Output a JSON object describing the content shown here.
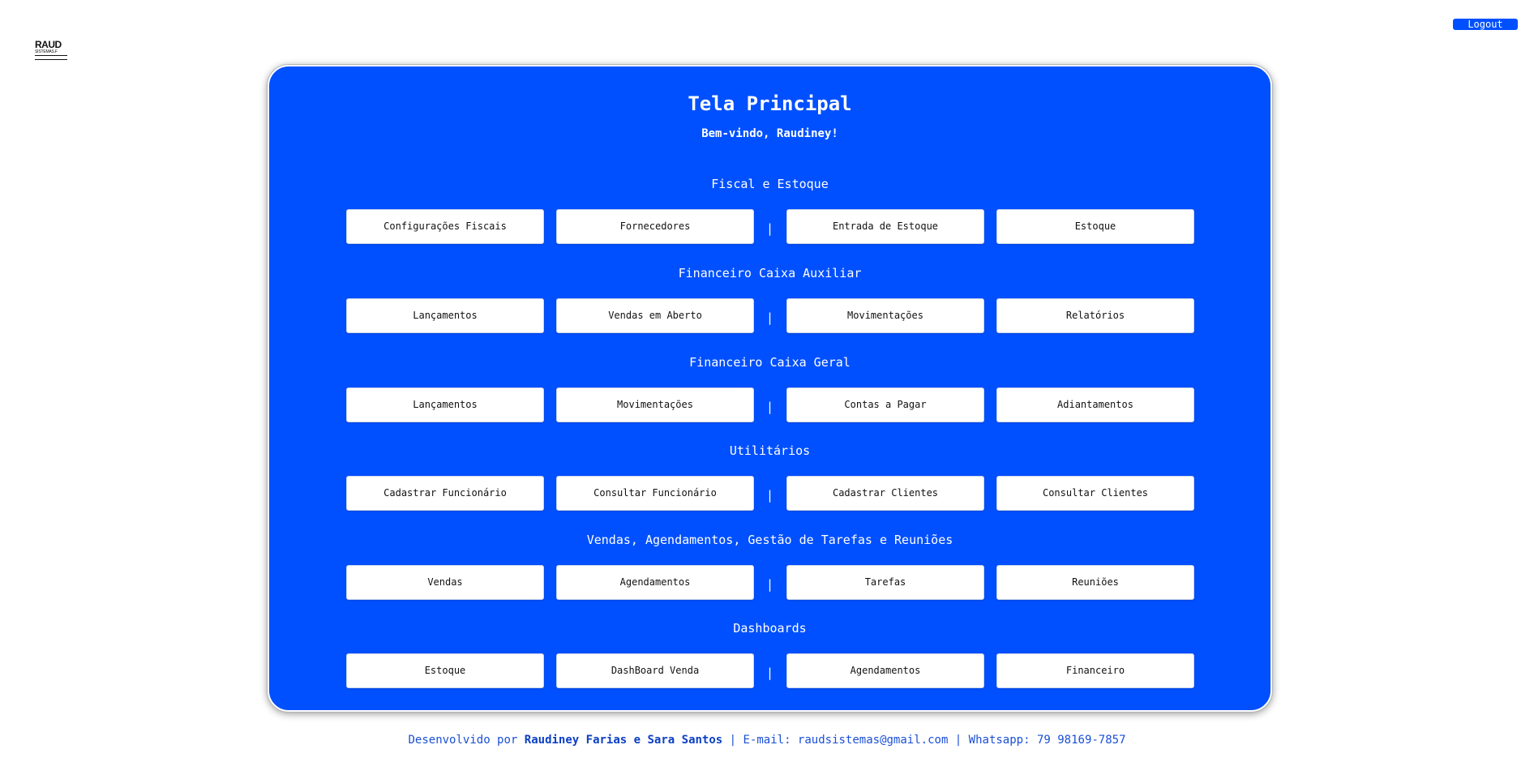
{
  "logo": {
    "main": "RAUD",
    "sub": "SISTEMAS.F"
  },
  "logout_label": "Logout",
  "panel": {
    "title": "Tela Principal",
    "welcome": "Bem-vindo, Raudiney!"
  },
  "separator": "|",
  "sections": [
    {
      "title": "Fiscal e Estoque",
      "buttons": [
        "Configurações Fiscais",
        "Fornecedores",
        "Entrada de Estoque",
        "Estoque"
      ]
    },
    {
      "title": "Financeiro Caixa Auxiliar",
      "buttons": [
        "Lançamentos",
        "Vendas em Aberto",
        "Movimentações",
        "Relatórios"
      ]
    },
    {
      "title": "Financeiro Caixa Geral",
      "buttons": [
        "Lançamentos",
        "Movimentações",
        "Contas a Pagar",
        "Adiantamentos"
      ]
    },
    {
      "title": "Utilitários",
      "buttons": [
        "Cadastrar Funcionário",
        "Consultar Funcionário",
        "Cadastrar Clientes",
        "Consultar Clientes"
      ]
    },
    {
      "title": "Vendas, Agendamentos, Gestão de Tarefas e Reuniões",
      "buttons": [
        "Vendas",
        "Agendamentos",
        "Tarefas",
        "Reuniões"
      ]
    },
    {
      "title": "Dashboards",
      "buttons": [
        "Estoque",
        "DashBoard Venda",
        "Agendamentos",
        "Financeiro"
      ]
    }
  ],
  "footer": {
    "prefix": "Desenvolvido por ",
    "authors": "Raudiney Farias e Sara Santos",
    "contact": " | E-mail: raudsistemas@gmail.com | Whatsapp: 79 98169-7857"
  },
  "colors": {
    "accent": "#0050ff",
    "button_bg": "#ffffff",
    "text_on_accent": "#ffffff"
  }
}
